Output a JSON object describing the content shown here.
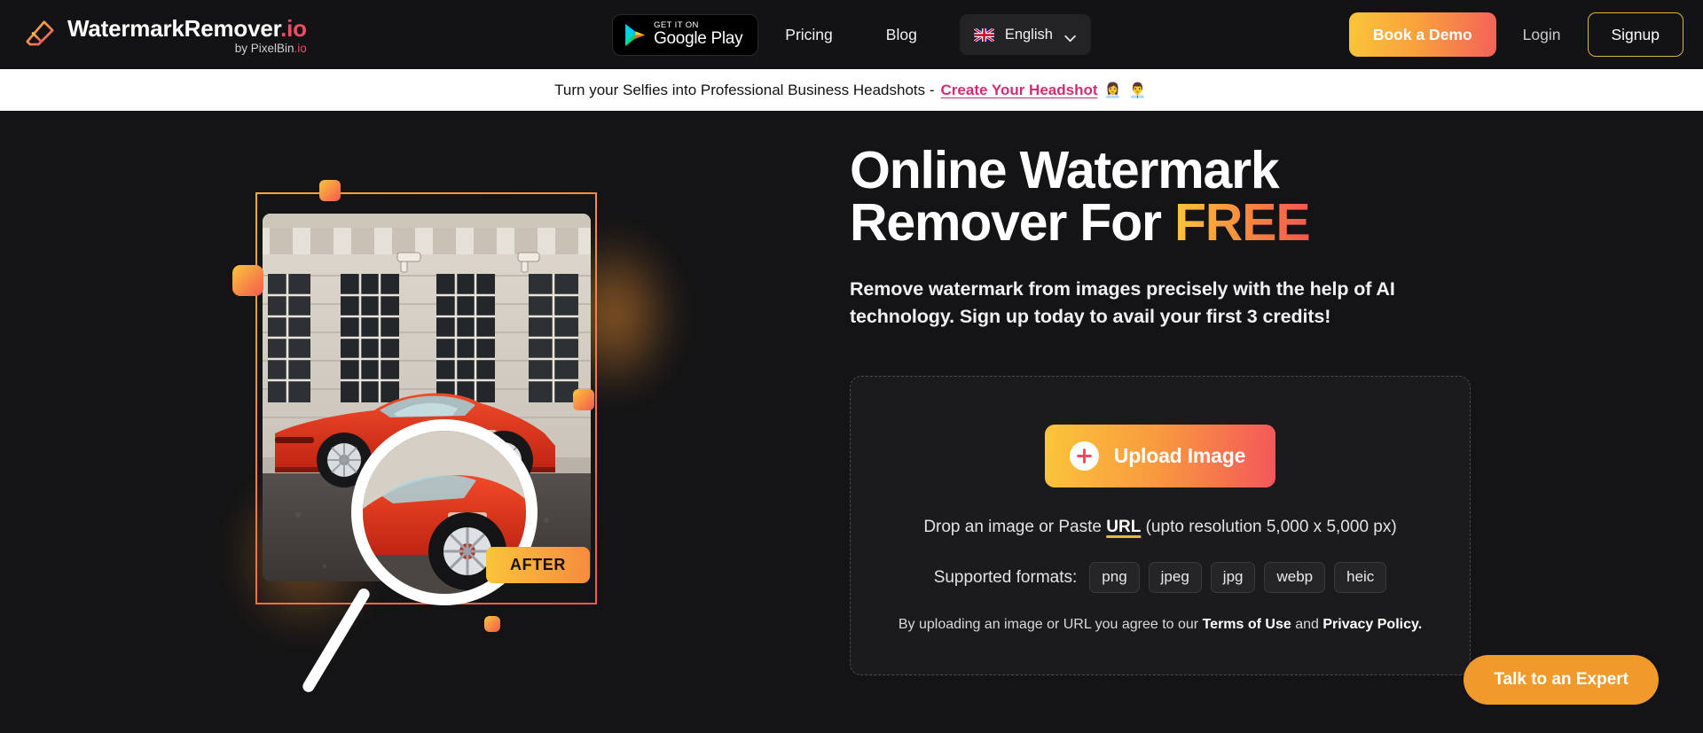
{
  "brand": {
    "name_main": "WatermarkRemover",
    "name_tld": ".io",
    "by_prefix": "by PixelBin",
    "by_tld": ".io",
    "logo_icon": "eraser-icon"
  },
  "nav": {
    "google_play": {
      "small": "GET IT ON",
      "large": "Google Play",
      "icon": "google-play-triangle-icon"
    },
    "links": [
      {
        "label": "Pricing"
      },
      {
        "label": "Blog"
      }
    ],
    "language": {
      "label": "English",
      "flag_icon": "uk-flag-icon",
      "chevron_icon": "chevron-down-icon"
    },
    "book_demo": "Book a Demo",
    "login": "Login",
    "signup": "Signup"
  },
  "banner": {
    "text": "Turn your Selfies into Professional Business Headshots -",
    "link": "Create Your Headshot",
    "emoji": "👩‍💼 👨‍💼"
  },
  "hero": {
    "headline_line1": "Online Watermark",
    "headline_line2_pre": "Remover For ",
    "headline_line2_accent": "FREE",
    "subhead": "Remove watermark from images precisely with the help of AI technology. Sign up today to avail your first 3 credits!",
    "art": {
      "after_badge": "AFTER",
      "loupe_icon": "magnifier-icon"
    }
  },
  "dropzone": {
    "upload_label": "Upload Image",
    "plus_icon": "plus-icon",
    "drop_pre": "Drop an image or Paste ",
    "drop_link": "URL",
    "drop_post": " (upto resolution 5,000 x 5,000 px)",
    "formats_label": "Supported formats:",
    "formats": [
      "png",
      "jpeg",
      "jpg",
      "webp",
      "heic"
    ],
    "terms_pre": "By uploading an image or URL you agree to our ",
    "terms_link1": "Terms of Use",
    "terms_mid": " and ",
    "terms_link2": "Privacy Policy."
  },
  "floating": {
    "talk_expert": "Talk to an Expert"
  },
  "colors": {
    "accent_yellow": "#fbc53a",
    "accent_orange": "#f58b3e",
    "accent_red": "#f4564f",
    "banner_link": "#d62b74",
    "signup_border": "#e0b53c",
    "talk_expert_bg": "#f09a2b",
    "page_bg": "#141416",
    "nav_bg": "#131315"
  }
}
